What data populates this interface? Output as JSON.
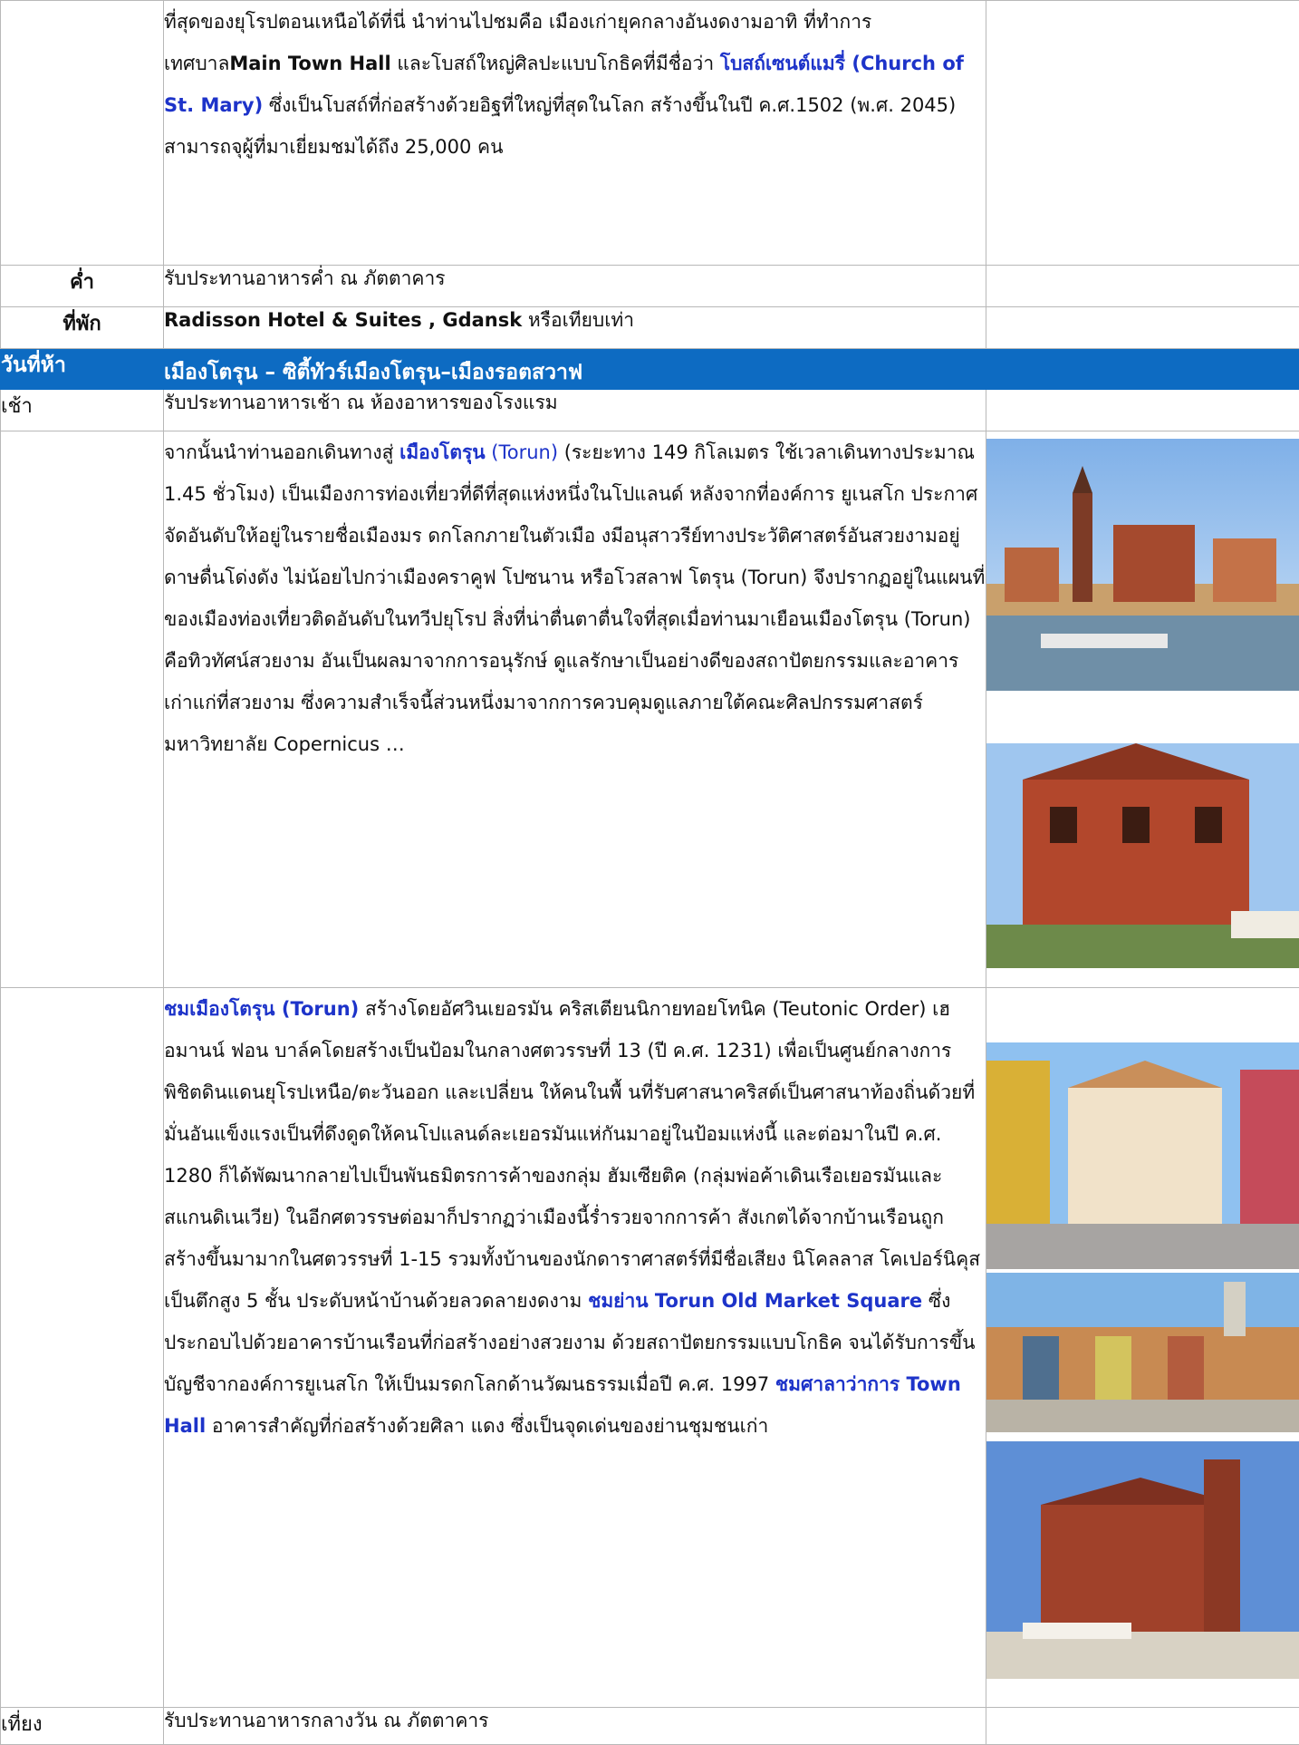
{
  "rows": {
    "continuation": {
      "parts": [
        {
          "text": "ที่สุดของยุโรปตอนเหนือได้ที่นี่ นำท่านไปชมคือ เมืองเก่ายุคกลางอันงดงามอาทิ ที่ทำการเทศบาล"
        },
        {
          "text": "Main Town Hall",
          "style": "bold"
        },
        {
          "text": " และโบสถ์ใหญ่ศิลปะแบบโกธิคที่มีชื่อว่า "
        },
        {
          "text": "โบสถ์เซนต์แมรี่ (Church of St. Mary)",
          "style": "hl"
        },
        {
          "text": " ซึ่งเป็นโบสถ์ที่ก่อสร้างด้วยอิฐที่ใหญ่ที่สุดในโลก สร้างขึ้นในปี ค.ศ.1502 (พ.ศ. 2045) สามารถจุผู้ที่มาเยี่ยมชมได้ถึง 25,000 คน"
        }
      ]
    },
    "dinner": {
      "label": "ค่ำ",
      "text": "รับประทานอาหารค่ำ ณ ภัตตาคาร"
    },
    "hotel": {
      "label": "ที่พัก",
      "name": "Radisson Hotel & Suites , Gdansk",
      "suffix": " หรือเทียบเท่า"
    },
    "day": {
      "label": "วันที่ห้า",
      "title": "เมืองโตรุน – ซิตี้ทัวร์เมืองโตรุน–เมืองรอตสวาฟ"
    },
    "breakfast": {
      "label": "เช้า",
      "text": "รับประทานอาหารเช้า ณ ห้องอาหารของโรงแรม"
    },
    "torun_intro": {
      "parts": [
        {
          "text": "จากนั้นนำท่านออกเดินทางสู่ "
        },
        {
          "text": "เมืองโตรุน",
          "style": "hl"
        },
        {
          "text": " (Torun)",
          "style": "blue-plain"
        },
        {
          "text": " (ระยะทาง 149 กิโลเมตร ใช้เวลาเดินทางประมาณ 1.45 ชั่วโมง) เป็นเมืองการท่องเที่ยวที่ดีที่สุดแห่งหนึ่งในโปแลนด์ หลังจากที่องค์การ ยูเนสโก ประกาศจัดอันดับให้อยู่ในรายชื่อเมืองมร ดกโลกภายในตัวเมือ งมีอนุสาวรีย์ทางประวัติศาสตร์อันสวยงามอยู่ดาษดื่นโด่งดัง ไม่น้อยไปกว่าเมืองคราคูฟ โปซนาน หรือโวสลาฟ โตรุน (Torun) จึงปรากฏอยู่ในแผนที่ของเมืองท่องเที่ยวติดอันดับในทวีปยุโรป สิ่งที่น่าตื่นตาตื่นใจที่สุดเมื่อท่านมาเยือนเมืองโตรุน (Torun) คือทิวทัศน์สวยงาม อันเป็นผลมาจากการอนุรักษ์ ดูแลรักษาเป็นอย่างดีของสถาปัตยกรรมและอาคารเก่าแก่ที่สวยงาม ซึ่งความสำเร็จนี้ส่วนหนึ่งมาจากการควบคุมดูแลภายใต้คณะศิลปกรรมศาสตร์มหาวิทยาลัย Copernicus …"
        }
      ]
    },
    "torun_tour": {
      "parts": [
        {
          "text": "ชมเมืองโตรุน (Torun)",
          "style": "hl"
        },
        {
          "text": " สร้างโดยอัศวินเยอรมัน คริสเตียนนิกายทอยโทนิค (Teutonic Order) เฮอมานน์ ฟอน บาล์คโดยสร้างเป็นป้อมในกลางศตวรรษที่ 13 (ปี ค.ศ. 1231) เพื่อเป็นศูนย์กลางการพิชิตดินแดนยุโรปเหนือ/ตะวันออก และเปลี่ยน ให้คนในพื้  นที่รับศาสนาคริสต์เป็นศาสนาท้องถิ่นด้วยที่มั่นอันแข็งแรงเป็นที่ดึงดูดให้คนโปแลนด์ละเยอรมันแห่กันมาอยู่ในป้อมแห่งนี้ และต่อมาในปี ค.ศ. 1280 ก็ได้พัฒนากลายไปเป็นพันธมิตรการค้าของกลุ่ม ฮัมเซียติค (กลุ่มพ่อค้าเดินเรือเยอรมันและสแกนดิเนเวีย) ในอีกศตวรรษต่อมาก็ปรากฏว่าเมืองนี้ร่ำรวยจากการค้า สังเกตได้จากบ้านเรือนถูกสร้างขึ้นมามากในศตวรรษที่ 1-15 รวมทั้งบ้านของนักดาราศาสตร์ที่มีชื่อเสียง นิโคลลาส โคเปอร์นิคุส เป็นตึกสูง 5 ชั้น ประดับหน้าบ้านด้วยลวดลายงดงาม "
        },
        {
          "text": "ชมย่าน Torun Old Market  Square",
          "style": "hl"
        },
        {
          "text": " ซึ่งประกอบไปด้วยอาคารบ้านเรือนที่ก่อสร้างอย่างสวยงาม ด้วยสถาปัตยกรรมแบบโกธิค จนได้รับการขึ้นบัญชีจากองค์การยูเนสโก ให้เป็นมรดกโลกด้านวัฒนธรรมเมื่อปี ค.ศ. 1997 "
        },
        {
          "text": "ชมศาลาว่าการ Town Hall",
          "style": "hl"
        },
        {
          "text": " อาคารสำคัญที่ก่อสร้างด้วยศิลา แดง ซึ่งเป็นจุดเด่นของย่านชุมชนเก่า"
        }
      ]
    },
    "lunch": {
      "label": "เที่ยง",
      "text": "รับประทานอาหารกลางวัน ณ ภัตตาคาร"
    }
  },
  "colors": {
    "day_header_bg": "#0d6bc2",
    "highlight": "#1d33c9",
    "border": "#b8b8b8"
  }
}
